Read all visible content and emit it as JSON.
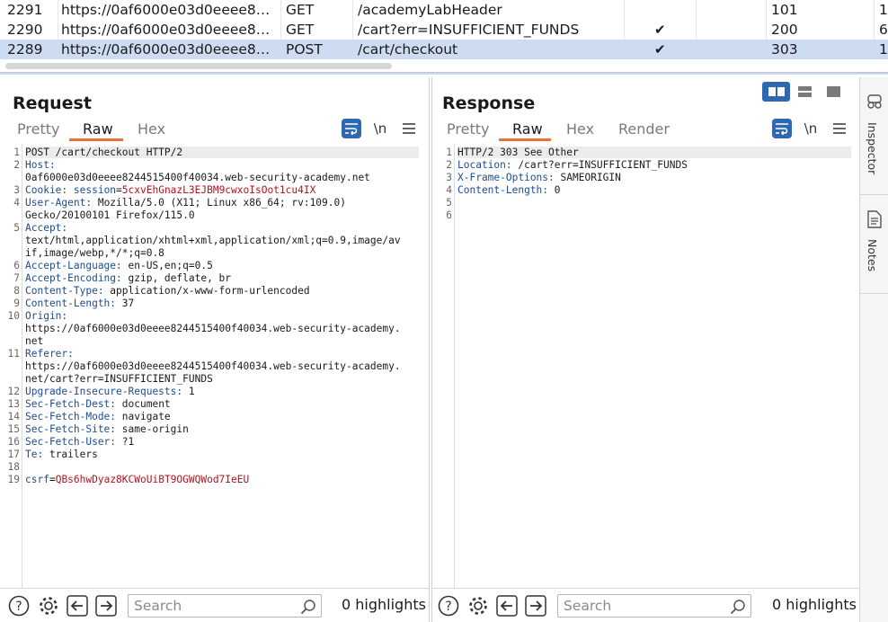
{
  "history": {
    "rows": [
      {
        "id": "2291",
        "host": "https://0af6000e03d0eeee8244515400f40034.web-security-academy.net",
        "method": "GET",
        "url": "/academyLabHeader",
        "edited": "",
        "status": "101",
        "length": "1"
      },
      {
        "id": "2290",
        "host": "https://0af6000e03d0eeee8244515400f40034.web-security-academy.net",
        "method": "GET",
        "url": "/cart?err=INSUFFICIENT_FUNDS",
        "edited": "✔",
        "status": "200",
        "length": "6"
      },
      {
        "id": "2289",
        "host": "https://0af6000e03d0eeee8244515400f40034.web-security-academy.net",
        "method": "POST",
        "url": "/cart/checkout",
        "edited": "✔",
        "status": "303",
        "length": "1"
      }
    ]
  },
  "request": {
    "title": "Request",
    "tabs": [
      "Pretty",
      "Raw",
      "Hex"
    ],
    "active_tab": "Raw",
    "tool_newline": "\\n",
    "lines": [
      {
        "n": "1",
        "parts": [
          {
            "t": "POST /cart/checkout HTTP/2",
            "c": ""
          }
        ]
      },
      {
        "n": "2",
        "parts": [
          {
            "t": "Host:",
            "c": "k"
          }
        ]
      },
      {
        "n": "",
        "parts": [
          {
            "t": "0af6000e03d0eeee8244515400f40034.web-security-academy.net",
            "c": ""
          }
        ]
      },
      {
        "n": "3",
        "parts": [
          {
            "t": "Cookie:",
            "c": "k"
          },
          {
            "t": " session",
            "c": "k"
          },
          {
            "t": "=",
            "c": ""
          },
          {
            "t": "5cxvEhGnazL3EJBM9cwxoIsOot1cu4IX",
            "c": "v-red"
          }
        ]
      },
      {
        "n": "4",
        "parts": [
          {
            "t": "User-Agent:",
            "c": "k"
          },
          {
            "t": " Mozilla/5.0 (X11; Linux x86_64; rv:109.0)",
            "c": ""
          }
        ]
      },
      {
        "n": "",
        "parts": [
          {
            "t": "Gecko/20100101 Firefox/115.0",
            "c": ""
          }
        ]
      },
      {
        "n": "5",
        "parts": [
          {
            "t": "Accept:",
            "c": "k"
          }
        ]
      },
      {
        "n": "",
        "parts": [
          {
            "t": "text/html,application/xhtml+xml,application/xml;q=0.9,image/av",
            "c": ""
          }
        ]
      },
      {
        "n": "",
        "parts": [
          {
            "t": "if,image/webp,*/*;q=0.8",
            "c": ""
          }
        ]
      },
      {
        "n": "6",
        "parts": [
          {
            "t": "Accept-Language:",
            "c": "k"
          },
          {
            "t": " en-US,en;q=0.5",
            "c": ""
          }
        ]
      },
      {
        "n": "7",
        "parts": [
          {
            "t": "Accept-Encoding:",
            "c": "k"
          },
          {
            "t": " gzip, deflate, br",
            "c": ""
          }
        ]
      },
      {
        "n": "8",
        "parts": [
          {
            "t": "Content-Type:",
            "c": "k"
          },
          {
            "t": " application/x-www-form-urlencoded",
            "c": ""
          }
        ]
      },
      {
        "n": "9",
        "parts": [
          {
            "t": "Content-Length:",
            "c": "k"
          },
          {
            "t": " 37",
            "c": ""
          }
        ]
      },
      {
        "n": "10",
        "parts": [
          {
            "t": "Origin:",
            "c": "k"
          }
        ]
      },
      {
        "n": "",
        "parts": [
          {
            "t": "https://0af6000e03d0eeee8244515400f40034.web-security-academy.",
            "c": ""
          }
        ]
      },
      {
        "n": "",
        "parts": [
          {
            "t": "net",
            "c": ""
          }
        ]
      },
      {
        "n": "11",
        "parts": [
          {
            "t": "Referer:",
            "c": "k"
          }
        ]
      },
      {
        "n": "",
        "parts": [
          {
            "t": "https://0af6000e03d0eeee8244515400f40034.web-security-academy.",
            "c": ""
          }
        ]
      },
      {
        "n": "",
        "parts": [
          {
            "t": "net/cart?err=INSUFFICIENT_FUNDS",
            "c": ""
          }
        ]
      },
      {
        "n": "12",
        "parts": [
          {
            "t": "Upgrade-Insecure-Requests:",
            "c": "k"
          },
          {
            "t": " 1",
            "c": ""
          }
        ]
      },
      {
        "n": "13",
        "parts": [
          {
            "t": "Sec-Fetch-Dest:",
            "c": "k"
          },
          {
            "t": " document",
            "c": ""
          }
        ]
      },
      {
        "n": "14",
        "parts": [
          {
            "t": "Sec-Fetch-Mode:",
            "c": "k"
          },
          {
            "t": " navigate",
            "c": ""
          }
        ]
      },
      {
        "n": "15",
        "parts": [
          {
            "t": "Sec-Fetch-Site:",
            "c": "k"
          },
          {
            "t": " same-origin",
            "c": ""
          }
        ]
      },
      {
        "n": "16",
        "parts": [
          {
            "t": "Sec-Fetch-User:",
            "c": "k"
          },
          {
            "t": " ?1",
            "c": ""
          }
        ]
      },
      {
        "n": "17",
        "parts": [
          {
            "t": "Te:",
            "c": "k"
          },
          {
            "t": " trailers",
            "c": ""
          }
        ]
      },
      {
        "n": "18",
        "parts": []
      },
      {
        "n": "19",
        "parts": [
          {
            "t": "csrf",
            "c": "k"
          },
          {
            "t": "=",
            "c": ""
          },
          {
            "t": "QBs6hwDyaz8KCWoUiBT9OGWQWod7IeEU",
            "c": "v-red"
          }
        ]
      }
    ],
    "search_placeholder": "Search",
    "highlights": "0 highlights"
  },
  "response": {
    "title": "Response",
    "tabs": [
      "Pretty",
      "Raw",
      "Hex",
      "Render"
    ],
    "active_tab": "Raw",
    "tool_newline": "\\n",
    "lines": [
      {
        "n": "1",
        "parts": [
          {
            "t": "HTTP/2 303 See Other",
            "c": ""
          }
        ]
      },
      {
        "n": "2",
        "parts": [
          {
            "t": "Location:",
            "c": "k"
          },
          {
            "t": " /cart?err=INSUFFICIENT_FUNDS",
            "c": ""
          }
        ]
      },
      {
        "n": "3",
        "parts": [
          {
            "t": "X-Frame-Options:",
            "c": "k"
          },
          {
            "t": " SAMEORIGIN",
            "c": ""
          }
        ]
      },
      {
        "n": "4",
        "parts": [
          {
            "t": "Content-Length:",
            "c": "k"
          },
          {
            "t": " 0",
            "c": ""
          }
        ]
      },
      {
        "n": "5",
        "parts": []
      },
      {
        "n": "6",
        "parts": []
      }
    ],
    "search_placeholder": "Search",
    "highlights": "0 highlights"
  },
  "sidebar": {
    "items": [
      "Inspector",
      "Notes"
    ]
  },
  "colors": {
    "accent": "#2f67b1",
    "tab_underline": "#e8733a",
    "selected_row": "#cddcf1",
    "header_key": "#1d4c8f",
    "value_red": "#b2131f"
  }
}
